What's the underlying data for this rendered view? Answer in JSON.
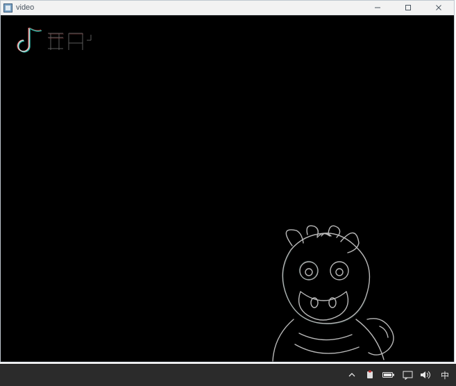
{
  "window": {
    "title": "video",
    "icon": "app-icon"
  },
  "window_controls": {
    "minimize": "minimize-icon",
    "maximize": "maximize-icon",
    "close": "close-icon"
  },
  "content": {
    "logo_label": "抖音",
    "figure_label": "cartoon-cow-outline"
  },
  "taskbar": {
    "tray_items": {
      "overflow": "chevron-up-icon",
      "app": "app-tray-icon",
      "battery": "battery-icon",
      "monitor": "monitor-icon",
      "volume": "volume-icon",
      "ime": "中"
    }
  }
}
